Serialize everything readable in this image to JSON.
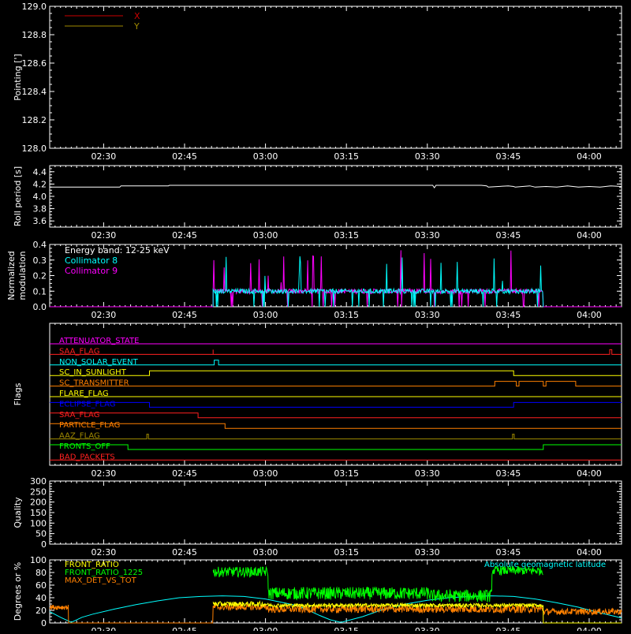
{
  "time_axis": {
    "start_min": 140,
    "end_min": 246,
    "ticks": [
      {
        "min": 150,
        "label": "02:30"
      },
      {
        "min": 165,
        "label": "02:45"
      },
      {
        "min": 180,
        "label": "03:00"
      },
      {
        "min": 195,
        "label": "03:15"
      },
      {
        "min": 210,
        "label": "03:30"
      },
      {
        "min": 225,
        "label": "03:45"
      },
      {
        "min": 240,
        "label": "04:00"
      }
    ]
  },
  "chart_data": [
    {
      "id": "pointing",
      "type": "line",
      "ylabel": "Pointing [']",
      "ylim": [
        128.0,
        129.0
      ],
      "yticks": [
        128.0,
        128.2,
        128.4,
        128.6,
        128.8,
        129.0
      ],
      "ytick_labels": [
        "128.0",
        "128.2",
        "128.4",
        "128.6",
        "128.8",
        "129.0"
      ],
      "legend": [
        {
          "label": "X",
          "color": "#cc0000"
        },
        {
          "label": "Y",
          "color": "#a08a00"
        }
      ],
      "series": [
        {
          "name": "X",
          "color": "#cc0000",
          "x": [],
          "y": []
        },
        {
          "name": "Y",
          "color": "#a08a00",
          "x": [],
          "y": []
        }
      ]
    },
    {
      "id": "roll",
      "type": "line",
      "ylabel": "Roll period [s]",
      "ylim": [
        3.5,
        4.5
      ],
      "yticks": [
        3.6,
        3.8,
        4.0,
        4.2,
        4.4
      ],
      "ytick_labels": [
        "3.6",
        "3.8",
        "4.0",
        "4.2",
        "4.4"
      ],
      "series": [
        {
          "color": "#ffffff",
          "x": [
            140,
            153,
            153.2,
            162,
            162.2,
            170.5,
            211,
            211.3,
            211.6,
            220,
            221,
            221.3,
            225,
            226,
            226.3,
            229,
            230,
            232,
            234,
            236,
            238,
            240,
            242,
            244,
            246
          ],
          "y": [
            4.15,
            4.15,
            4.17,
            4.17,
            4.18,
            4.18,
            4.18,
            4.14,
            4.18,
            4.18,
            4.17,
            4.15,
            4.17,
            4.16,
            4.15,
            4.17,
            4.15,
            4.16,
            4.15,
            4.17,
            4.15,
            4.16,
            4.15,
            4.17,
            4.16
          ]
        }
      ]
    },
    {
      "id": "modulation",
      "type": "line",
      "ylabel": [
        "Normalized",
        "modulation"
      ],
      "ylim": [
        0,
        0.4
      ],
      "yticks": [
        0,
        0.1,
        0.2,
        0.3,
        0.4
      ],
      "ytick_labels": [
        "0.0",
        "0.1",
        "0.2",
        "0.3",
        "0.4"
      ],
      "annotation": "Energy band: 12-25 keV",
      "legend": [
        {
          "label": "Collimator 8",
          "color": "#00ffff"
        },
        {
          "label": "Collimator 9",
          "color": "#ff00ff"
        }
      ],
      "active_range": [
        170.3,
        231.5
      ],
      "baseline": 0.1,
      "series": [
        {
          "name": "Collimator 8",
          "color": "#00ffff"
        },
        {
          "name": "Collimator 9",
          "color": "#ff00ff"
        }
      ]
    },
    {
      "id": "flags",
      "type": "step",
      "ylabel": "Flags",
      "flags": [
        {
          "label": "ATTENUATOR_STATE",
          "color": "#ff00ff",
          "transitions": []
        },
        {
          "label": "SAA_FLAG",
          "color": "#ff2020",
          "transitions": [
            [
              170.3,
              1
            ],
            [
              170.3,
              0
            ],
            [
              243.8,
              1
            ],
            [
              244.2,
              0
            ]
          ]
        },
        {
          "label": "NON_SOLAR_EVENT",
          "color": "#00ffff",
          "transitions": [
            [
              170.5,
              1
            ],
            [
              171.3,
              0
            ]
          ]
        },
        {
          "label": "SC_IN_SUNLIGHT",
          "color": "#ffff00",
          "transitions": [
            [
              158.5,
              1
            ],
            [
              226.0,
              0
            ]
          ]
        },
        {
          "label": "SC_TRANSMITTER",
          "color": "#ff8000",
          "transitions": [
            [
              222.5,
              1
            ],
            [
              226.5,
              0
            ],
            [
              227.0,
              1
            ],
            [
              231.5,
              0
            ],
            [
              232.0,
              1
            ],
            [
              237.5,
              0
            ]
          ]
        },
        {
          "label": "FLARE_FLAG",
          "color": "#ffff00",
          "transitions": []
        },
        {
          "label": "ECLIPSE_FLAG",
          "color": "#0000ff",
          "transitions": [
            [
              140,
              1
            ],
            [
              158.5,
              0
            ],
            [
              226.0,
              1
            ]
          ]
        },
        {
          "label": "SAA_FLAG",
          "color": "#ff2020",
          "transitions": [
            [
              140,
              1
            ],
            [
              167.5,
              0
            ]
          ]
        },
        {
          "label": "PARTICLE_FLAG",
          "color": "#ff8000",
          "transitions": [
            [
              140,
              1
            ],
            [
              172.5,
              0
            ]
          ]
        },
        {
          "label": "AAZ_FLAG",
          "color": "#a08a00",
          "transitions": [
            [
              158.0,
              1
            ],
            [
              158.3,
              0
            ],
            [
              225.8,
              1
            ],
            [
              226.1,
              0
            ]
          ]
        },
        {
          "label": "FRONTS_OFF",
          "color": "#00ff00",
          "transitions": [
            [
              140,
              1
            ],
            [
              154.5,
              0
            ],
            [
              231.5,
              1
            ]
          ]
        },
        {
          "label": "BAD_PACKETS",
          "color": "#ff2020",
          "transitions": []
        }
      ]
    },
    {
      "id": "quality",
      "type": "line",
      "ylabel": "Quality",
      "ylim": [
        0,
        300
      ],
      "yticks": [
        0,
        50,
        100,
        150,
        200,
        250,
        300
      ],
      "ytick_labels": [
        "0",
        "50",
        "100",
        "150",
        "200",
        "250",
        "300"
      ],
      "series": []
    },
    {
      "id": "ratios",
      "type": "line",
      "ylabel": "Degrees or %",
      "ylim": [
        0,
        100
      ],
      "yticks": [
        0,
        20,
        40,
        60,
        80,
        100
      ],
      "ytick_labels": [
        "0",
        "20",
        "40",
        "60",
        "80",
        "100"
      ],
      "legend": [
        {
          "label": "FRONT_RATIO",
          "color": "#ffff00"
        },
        {
          "label": "FRONT_RATIO_1225",
          "color": "#00ff00"
        },
        {
          "label": "MAX_DET_VS_TOT",
          "color": "#ff8000"
        }
      ],
      "right_label": {
        "text": "Absolute geomagnetic latitude",
        "color": "#00ffff"
      },
      "series": [
        {
          "name": "Absolute geomagnetic latitude",
          "color": "#00ffff",
          "x": [
            140,
            142,
            144,
            146,
            148,
            152,
            156,
            160,
            164,
            168,
            172,
            176,
            180,
            184,
            186,
            188,
            190,
            192,
            194,
            198,
            202,
            206,
            210,
            214,
            218,
            222,
            226,
            230,
            234,
            238,
            242,
            246
          ],
          "y": [
            18,
            9,
            1,
            9,
            14,
            22,
            29,
            35,
            40,
            42,
            43,
            42,
            38,
            31,
            27,
            20,
            12,
            5,
            1,
            10,
            22,
            30,
            36,
            40,
            42,
            43,
            42,
            38,
            32,
            25,
            16,
            8
          ]
        },
        {
          "name": "FRONT_RATIO_1225",
          "color": "#00ff00",
          "segments": [
            [
              170.3,
              180.5,
              81,
              8
            ],
            [
              180.5,
              210.5,
              47,
              10
            ],
            [
              210.5,
              222.0,
              43,
              10
            ],
            [
              222.0,
              231.5,
              83,
              7
            ]
          ]
        },
        {
          "name": "MAX_DET_VS_TOT",
          "color": "#ff8000",
          "segments": [
            [
              140,
              143.5,
              25,
              4
            ],
            [
              143.5,
              170.3,
              0,
              0
            ],
            [
              170.3,
              180.5,
              25,
              5
            ],
            [
              180.5,
              231.5,
              22,
              6
            ],
            [
              231.5,
              246,
              18,
              5
            ]
          ]
        },
        {
          "name": "FRONT_RATIO",
          "color": "#ffff00",
          "segments": [
            [
              170.3,
              180.5,
              30,
              4
            ],
            [
              180.5,
              231.5,
              28,
              3
            ],
            [
              231.5,
              246,
              0,
              0
            ]
          ]
        }
      ]
    }
  ]
}
